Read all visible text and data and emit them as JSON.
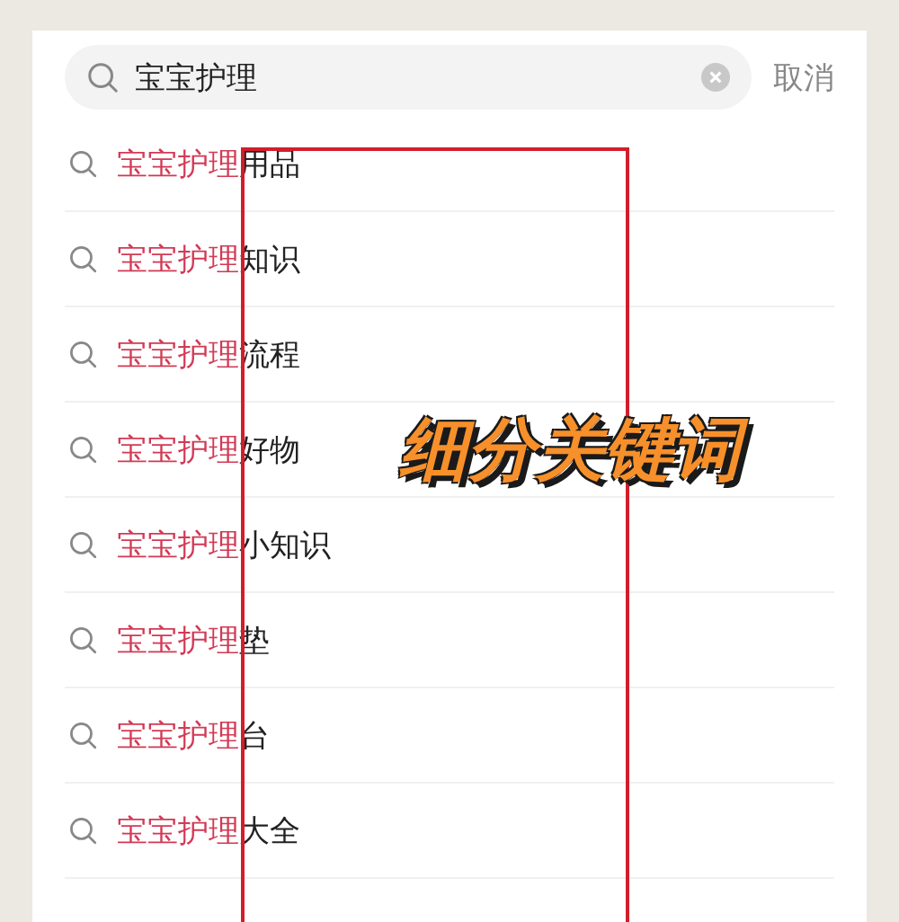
{
  "search": {
    "value": "宝宝护理",
    "cancel": "取消"
  },
  "suggestions": [
    {
      "match": "宝宝护理",
      "rest": "用品"
    },
    {
      "match": "宝宝护理",
      "rest": "知识"
    },
    {
      "match": "宝宝护理",
      "rest": "流程"
    },
    {
      "match": "宝宝护理",
      "rest": "好物"
    },
    {
      "match": "宝宝护理",
      "rest": "小知识"
    },
    {
      "match": "宝宝护理",
      "rest": "垫"
    },
    {
      "match": "宝宝护理",
      "rest": "台"
    },
    {
      "match": "宝宝护理",
      "rest": "大全"
    }
  ],
  "annotation": {
    "caption": "细分关键词"
  }
}
